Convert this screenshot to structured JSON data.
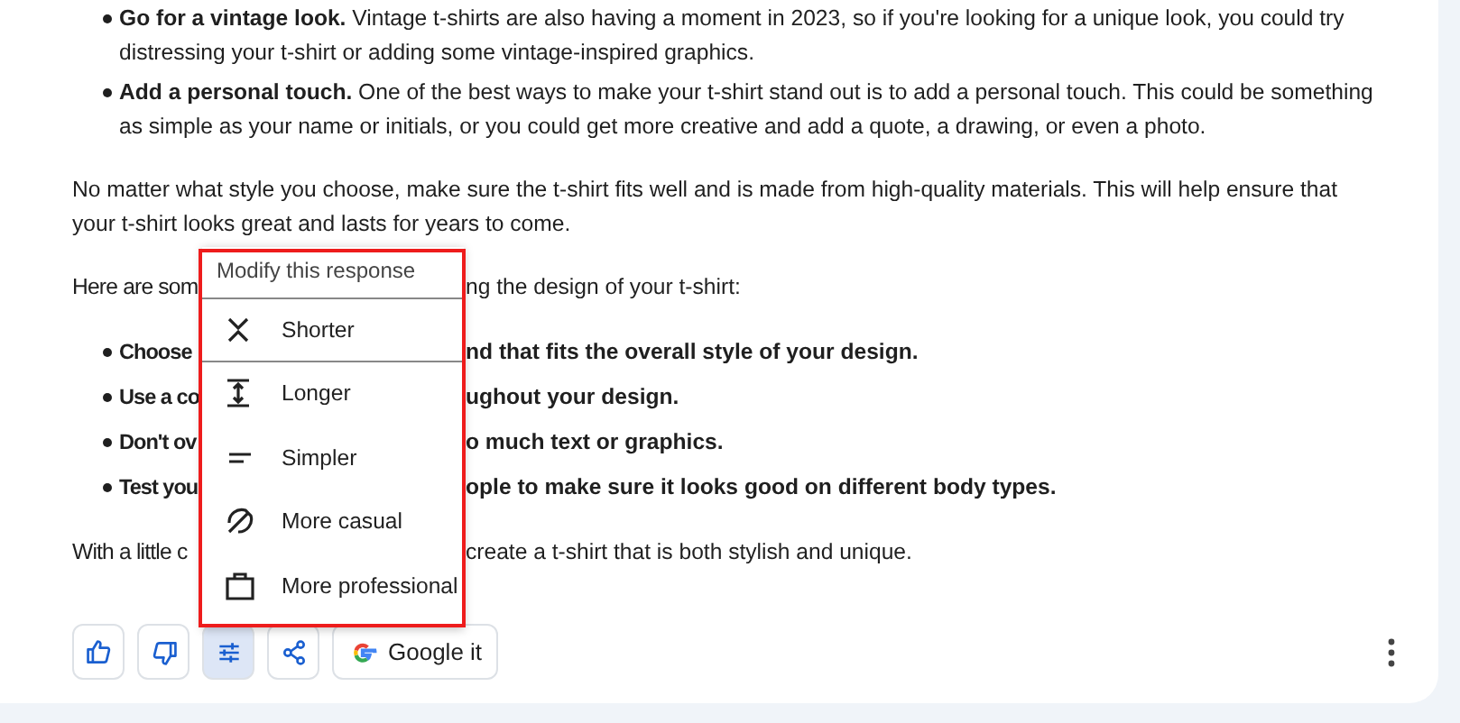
{
  "top_bullets": [
    "**Go for a vintage look.** Vintage t-shirts are also having a moment in 2023, so if you're looking for a unique look, you could try distressing your t-shirt or adding some vintage-inspired graphics.",
    "**Add a personal touch.** One of the best ways to make your t-shirt stand out is to add a personal touch. This could be something as simple as your name or initials, or you could get more creative and add a quote, a drawing, or even a photo."
  ],
  "paragraph": "No matter what style you choose, make sure the t-shirt fits well and is made from high-quality materials. This will help ensure that your t-shirt looks great and lasts for years to come.",
  "partial_lines": [
    {
      "kind": "paragraph",
      "left": "Here are som",
      "right": "ng the design of your t-shirt:"
    },
    {
      "kind": "bullet",
      "left": "Choose",
      "right": "nd that fits the overall style of your design."
    },
    {
      "kind": "bullet",
      "left": "Use a co",
      "right": "ughout your design."
    },
    {
      "kind": "bullet",
      "left": "Don't ov",
      "right": "o much text or graphics."
    },
    {
      "kind": "bullet",
      "left": "Test you",
      "right": "ople to make sure it looks good on different body types."
    },
    {
      "kind": "paragraph",
      "left": "With a little c",
      "right": "create a t-shirt that is both stylish and unique."
    }
  ],
  "menu": {
    "title": "Modify this response",
    "items": [
      {
        "kind": "shorter",
        "label": "Shorter",
        "selected": true
      },
      {
        "kind": "longer",
        "label": "Longer",
        "selected": false
      },
      {
        "kind": "simpler",
        "label": "Simpler",
        "selected": false
      },
      {
        "kind": "casual",
        "label": "More casual",
        "selected": false
      },
      {
        "kind": "professional",
        "label": "More professional",
        "selected": false
      }
    ]
  },
  "actions": [
    {
      "kind": "thumbs-up",
      "selected": false
    },
    {
      "kind": "thumbs-down",
      "selected": false
    },
    {
      "kind": "tune",
      "selected": true
    },
    {
      "kind": "share",
      "selected": false
    },
    {
      "kind": "google",
      "label": "Google it",
      "selected": false
    }
  ]
}
